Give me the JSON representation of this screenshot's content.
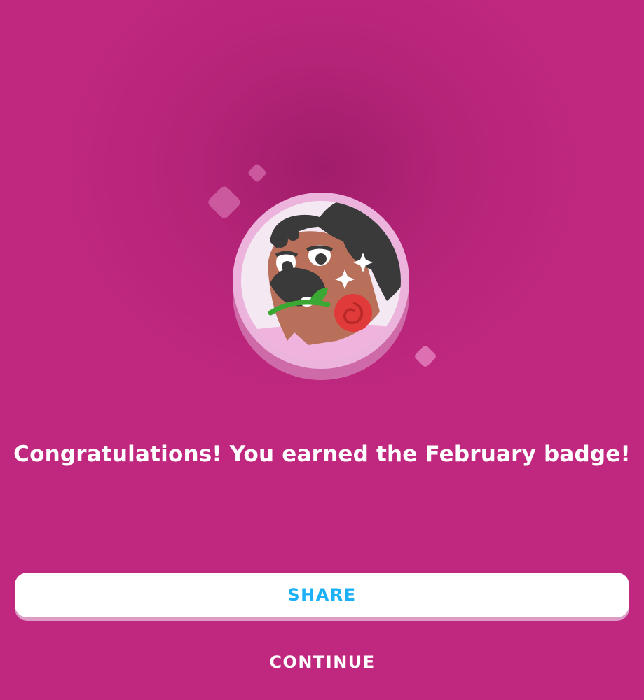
{
  "colors": {
    "background": "#c0287f",
    "button_text_share": "#1cb0f6",
    "button_background_share": "#ffffff",
    "text": "#ffffff"
  },
  "badge": {
    "icon": "february-badge-icon",
    "sparkles": [
      "sparkle-icon",
      "sparkle-icon",
      "sparkle-icon"
    ]
  },
  "message": "Congratulations! You earned the February badge!",
  "actions": {
    "share_label": "SHARE",
    "continue_label": "CONTINUE"
  }
}
